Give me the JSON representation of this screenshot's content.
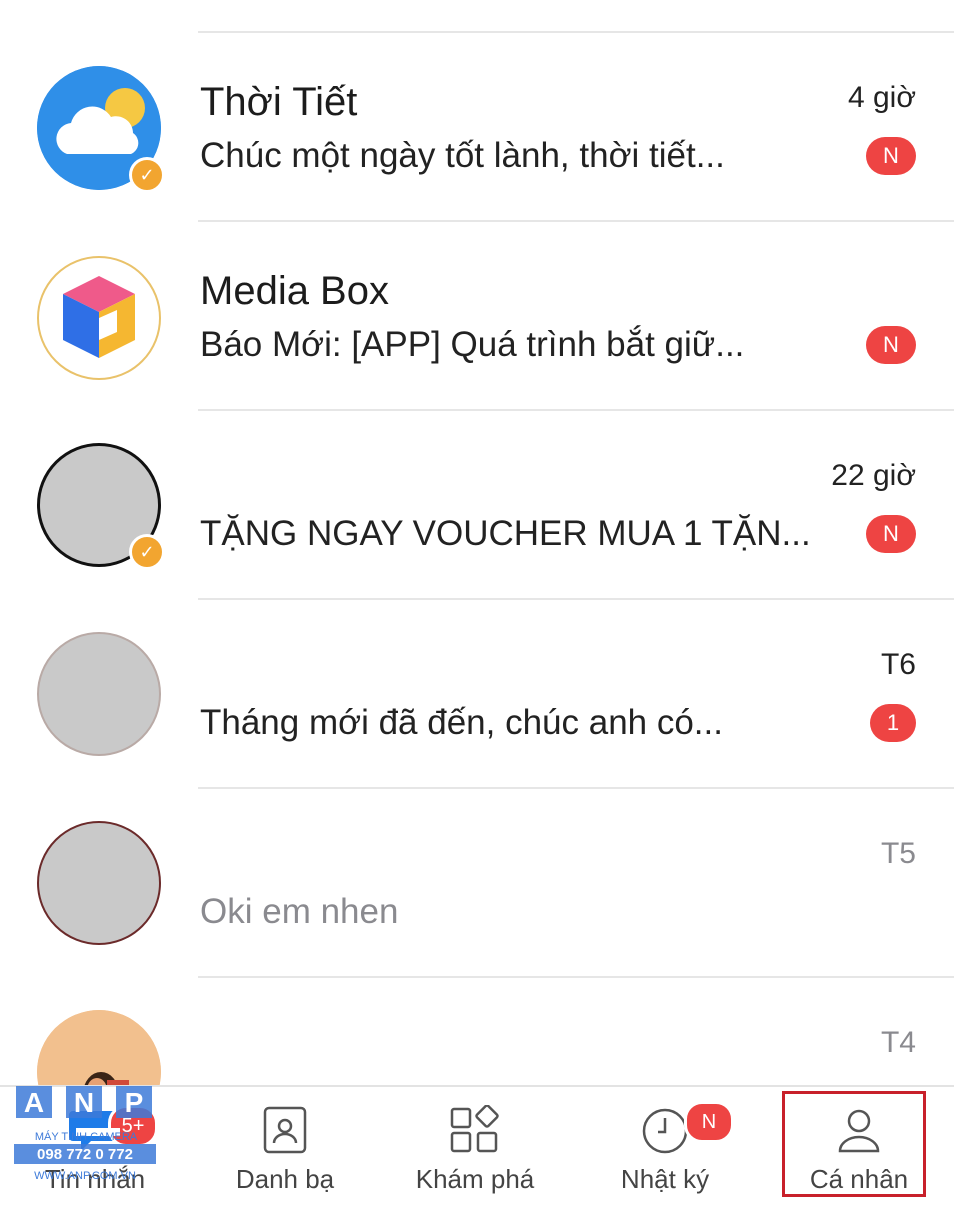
{
  "conversations": [
    {
      "title": "Thời Tiết",
      "preview": "Chúc một ngày tốt lành, thời tiết...",
      "time": "4 giờ",
      "badge": "N",
      "verified": true
    },
    {
      "title": "Media Box",
      "preview": "Báo Mới: [APP] Quá trình bắt giữ...",
      "time": "",
      "badge": "N",
      "verified": false
    },
    {
      "title": "",
      "preview": "TẶNG NGAY VOUCHER MUA 1 TẶN...",
      "time": "22 giờ",
      "badge": "N",
      "verified": true
    },
    {
      "title": "",
      "preview": "Tháng mới đã đến, chúc anh có...",
      "time": "T6",
      "badge": "1",
      "verified": false
    },
    {
      "title": "",
      "preview": "Oki em nhen",
      "time": "T5",
      "badge": "",
      "verified": false
    },
    {
      "title": "",
      "preview": "",
      "time": "T4",
      "badge": "",
      "verified": false
    }
  ],
  "tabs": {
    "messages": {
      "label": "Tin nhắn",
      "badge": "5+"
    },
    "contacts": {
      "label": "Danh bạ"
    },
    "discover": {
      "label": "Khám phá"
    },
    "timeline": {
      "label": "Nhật ký",
      "badge": "N"
    },
    "profile": {
      "label": "Cá nhân",
      "active": true
    }
  },
  "watermark": {
    "brand": "ANP",
    "tagline": "MÁY TÍNH CAMERA",
    "phone": "098 772 0 772",
    "website": "WWW.ANP.COM.VN"
  },
  "colors": {
    "badge": "#ee4443",
    "verified": "#f2a530",
    "highlight_box": "#c8202a",
    "weather_blue": "#2f8fe8"
  }
}
